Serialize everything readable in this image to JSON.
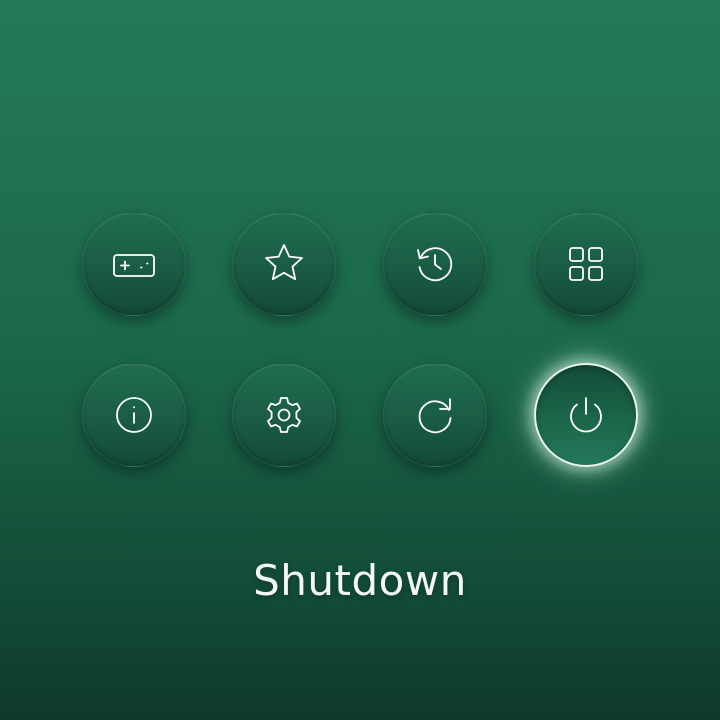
{
  "menu": {
    "items": [
      {
        "id": "games",
        "icon": "gamepad-icon",
        "selected": false
      },
      {
        "id": "favorites",
        "icon": "star-icon",
        "selected": false
      },
      {
        "id": "history",
        "icon": "history-clock-icon",
        "selected": false
      },
      {
        "id": "apps",
        "icon": "grid-icon",
        "selected": false
      },
      {
        "id": "info",
        "icon": "info-icon",
        "selected": false
      },
      {
        "id": "settings",
        "icon": "gear-icon",
        "selected": false
      },
      {
        "id": "restart",
        "icon": "restart-icon",
        "selected": false
      },
      {
        "id": "shutdown",
        "icon": "power-icon",
        "selected": true
      }
    ]
  },
  "selected_label": "Shutdown",
  "colors": {
    "background_top": "#237a57",
    "background_bottom": "#0f3a2b",
    "button": "#1a5c43",
    "icon": "#ffffff",
    "selection_glow": "#e9f5ee"
  }
}
